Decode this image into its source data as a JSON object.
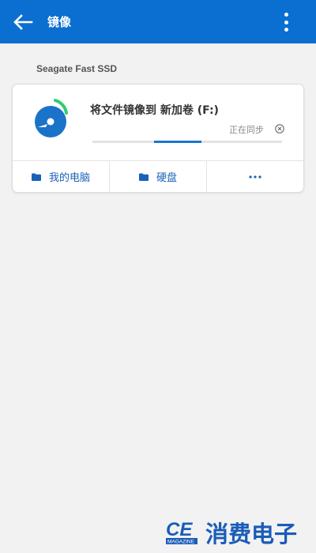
{
  "header": {
    "title": "镜像",
    "back_icon": "arrow-left-icon",
    "menu_icon": "more-vertical-icon"
  },
  "section": {
    "label": "Seagate Fast SSD"
  },
  "card": {
    "disk_icon": "disk-sync-icon",
    "title": "将文件镜像到 新加卷 (F:)",
    "status": "正在同步",
    "cancel_icon": "close-circle-icon",
    "progress_indeterminate": true,
    "actions": [
      {
        "label": "我的电脑",
        "icon": "folder-icon"
      },
      {
        "label": "硬盘",
        "icon": "folder-icon"
      },
      {
        "label": "",
        "icon": "more-horizontal-icon"
      }
    ]
  },
  "watermark": {
    "logo_text": "CE",
    "logo_subtext": "MAGAZINE",
    "brand_text": "消费电子"
  },
  "colors": {
    "primary": "#0a6fd0",
    "accent": "#1976d2",
    "sync_green": "#2ecc71",
    "link_blue": "#1a62b8",
    "background": "#f2f2f2"
  }
}
